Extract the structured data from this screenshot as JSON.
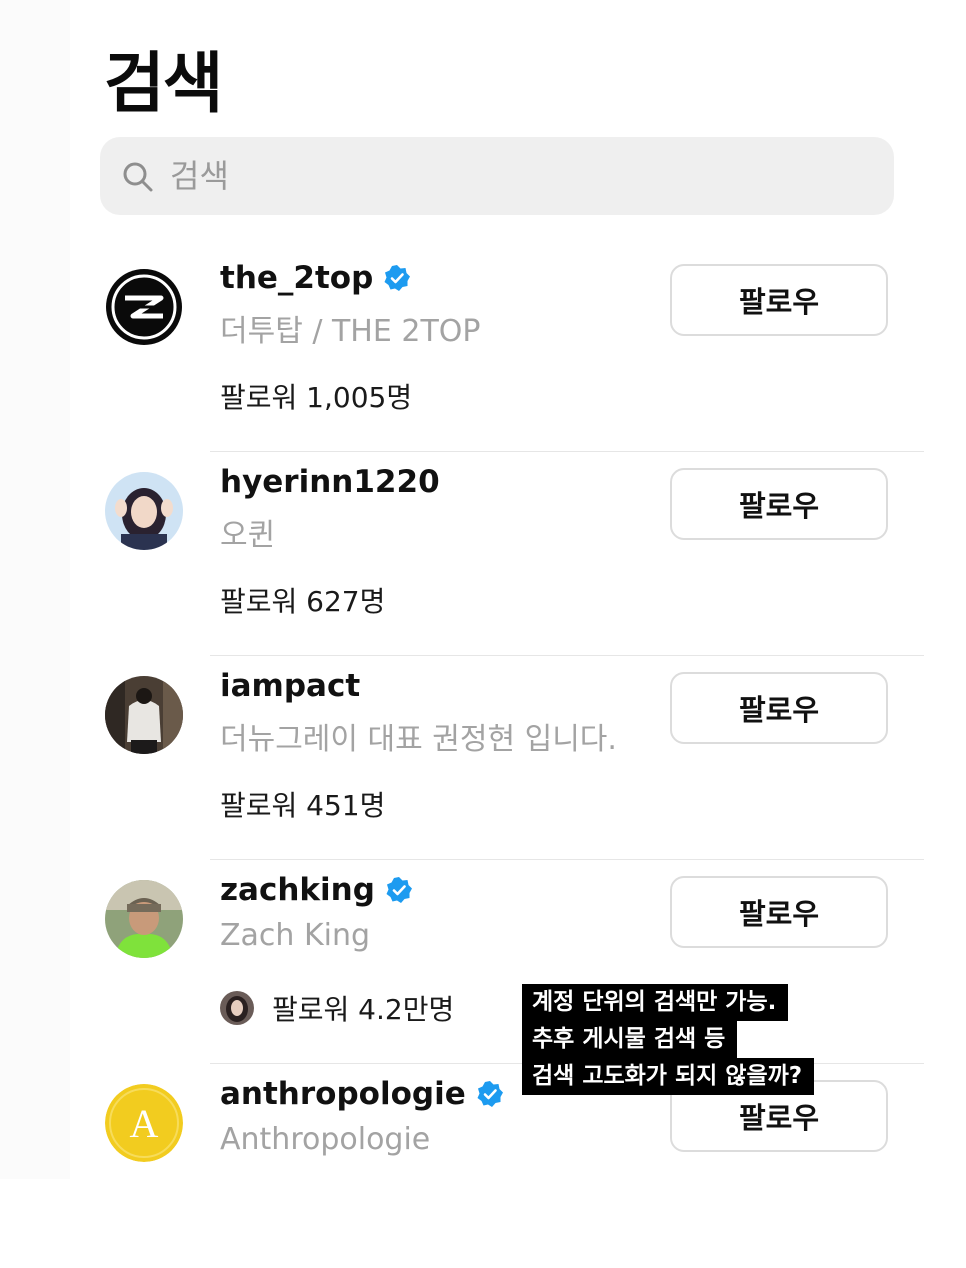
{
  "header": {
    "title": "검색"
  },
  "search": {
    "placeholder": "검색",
    "value": ""
  },
  "follow_label": "팔로우",
  "results": [
    {
      "username": "the_2top",
      "verified": true,
      "full_name": "더투탑 / THE 2TOP",
      "followers": "팔로워 1,005명",
      "avatar": "the2top-logo"
    },
    {
      "username": "hyerinn1220",
      "verified": false,
      "full_name": "오퀸",
      "followers": "팔로워 627명",
      "avatar": "user-photo"
    },
    {
      "username": "iampact",
      "verified": false,
      "full_name": "더뉴그레이 대표 권정현 입니다.",
      "followers": "팔로워 451명",
      "avatar": "user-photo"
    },
    {
      "username": "zachking",
      "verified": true,
      "full_name": "Zach King",
      "followers": "팔로워 4.2만명",
      "avatar": "user-photo"
    },
    {
      "username": "anthropologie",
      "verified": true,
      "full_name": "Anthropologie",
      "followers": "",
      "avatar": "letter-a-logo",
      "avatar_letter": "A"
    }
  ],
  "caption": {
    "lines": [
      "계정 단위의 검색만 가능.",
      "추후 게시물 검색 등",
      "검색 고도화가 되지 않을까?"
    ]
  },
  "colors": {
    "verified": "#1d9bf0",
    "placeholder": "#9a9a9a",
    "subtext": "#a3a3a3",
    "search_bg": "#efefef"
  }
}
